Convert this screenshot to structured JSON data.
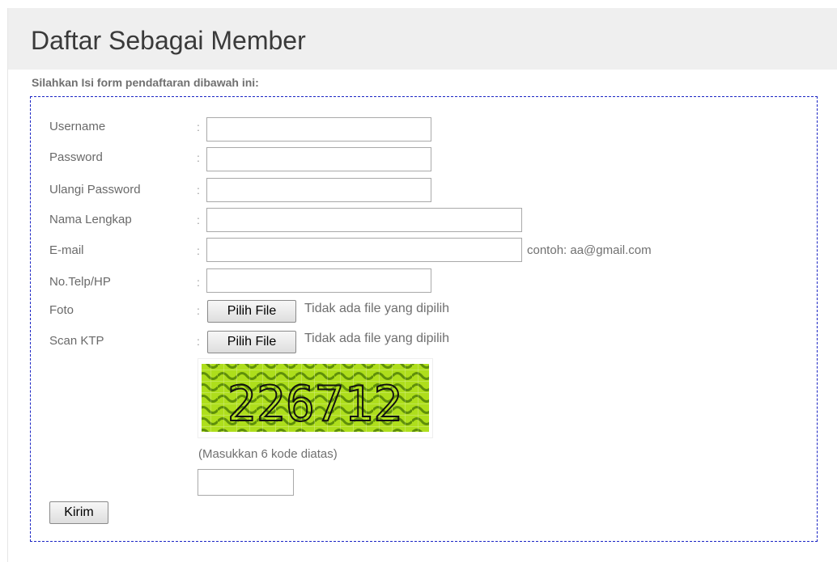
{
  "header": {
    "title": "Daftar Sebagai Member"
  },
  "form": {
    "intro": "Silahkan Isi form pendaftaran dibawah ini:",
    "separator": ":",
    "fields": {
      "username": {
        "label": "Username",
        "value": ""
      },
      "password": {
        "label": "Password",
        "value": ""
      },
      "password_repeat": {
        "label": "Ulangi Password",
        "value": ""
      },
      "full_name": {
        "label": "Nama Lengkap",
        "value": ""
      },
      "email": {
        "label": "E-mail",
        "value": "",
        "hint": "contoh: aa@gmail.com"
      },
      "phone": {
        "label": "No.Telp/HP",
        "value": ""
      },
      "photo": {
        "label": "Foto",
        "button": "Pilih File",
        "status": "Tidak ada file yang dipilih"
      },
      "id_scan": {
        "label": "Scan KTP",
        "button": "Pilih File",
        "status": "Tidak ada file yang dipilih"
      }
    },
    "captcha": {
      "code": "226712",
      "instruction": "(Masukkan 6 kode diatas)",
      "value": "",
      "colors": {
        "light": "#aede1c",
        "dark": "#5f8f0a",
        "text": "#111111"
      }
    },
    "submit_label": "Kirim"
  }
}
